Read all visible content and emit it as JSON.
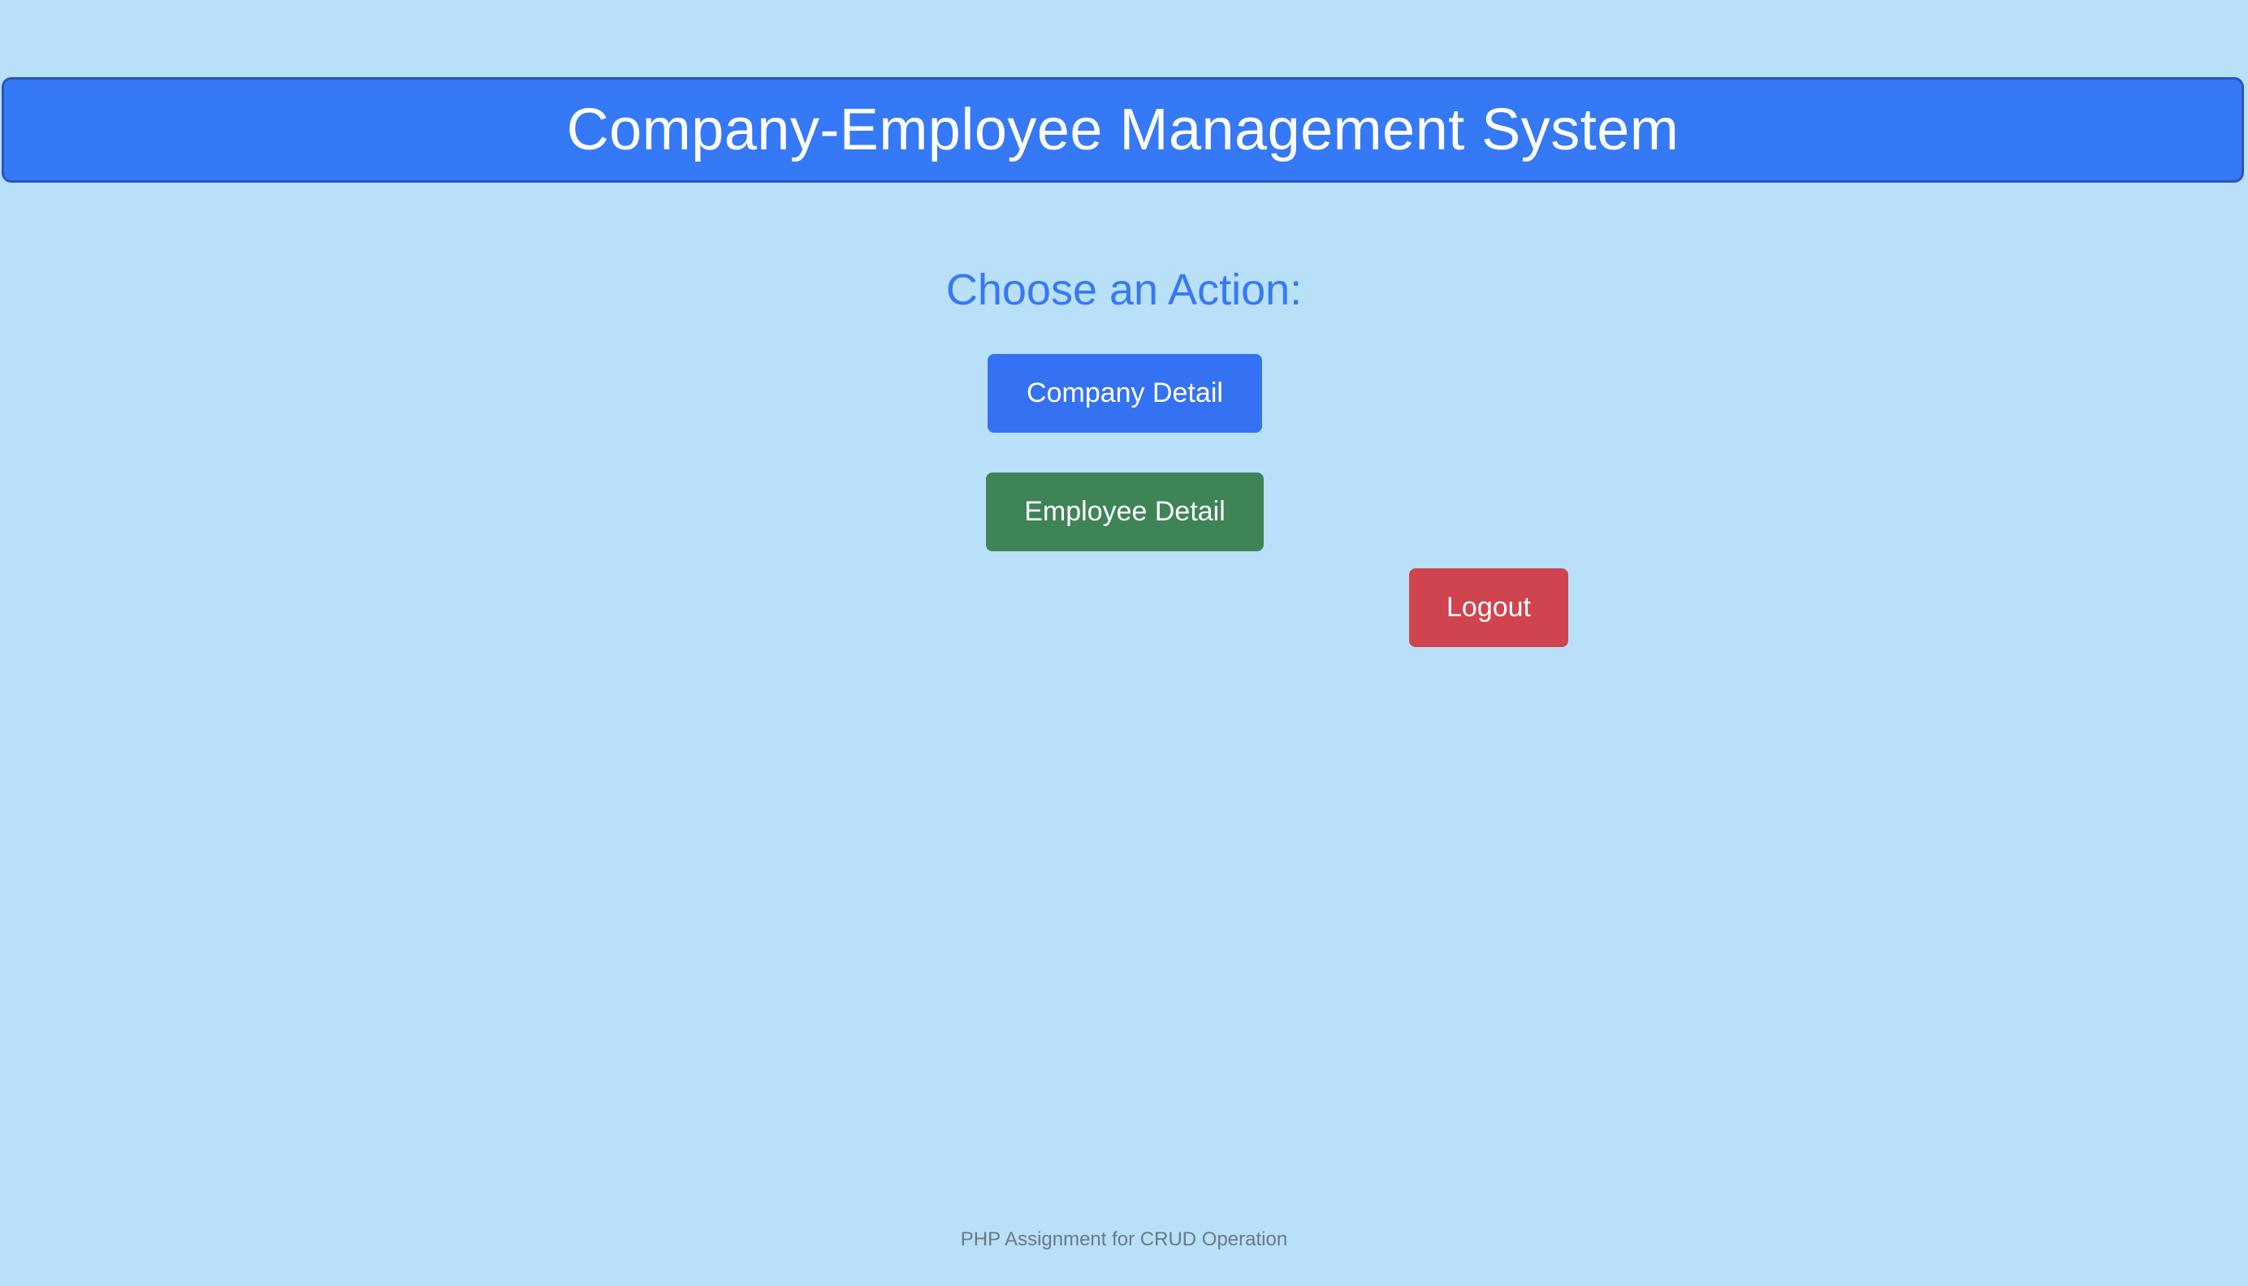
{
  "header": {
    "title": "Company-Employee Management System"
  },
  "main": {
    "prompt": "Choose an Action:",
    "buttons": {
      "company_detail": "Company Detail",
      "employee_detail": "Employee Detail",
      "logout": "Logout"
    }
  },
  "footer": {
    "text": "PHP Assignment for CRUD Operation"
  },
  "colors": {
    "background": "#b9e0f9",
    "header": "#3579f6",
    "primary_button": "#3571f3",
    "success_button": "#3e8457",
    "danger_button": "#cf444e"
  }
}
